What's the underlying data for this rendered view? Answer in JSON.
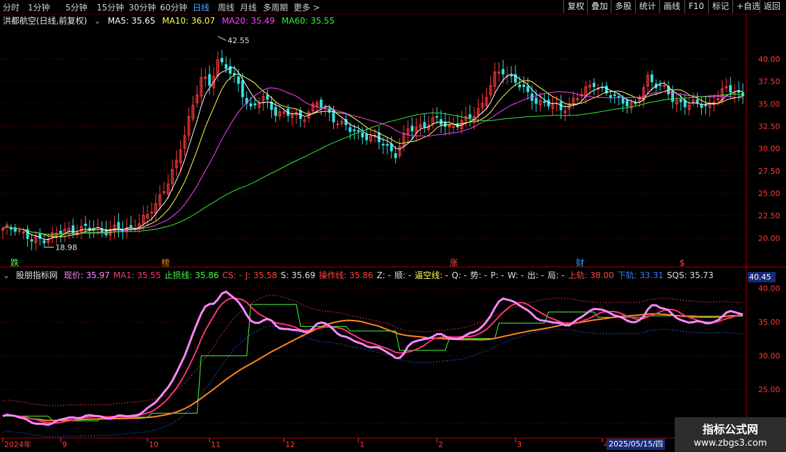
{
  "toolbar": {
    "periods": [
      "分时",
      "1分钟",
      "5分钟",
      "15分钟",
      "30分钟",
      "60分钟",
      "日线",
      "周线",
      "月线",
      "多周期",
      "更多 >"
    ],
    "active_period": "日线",
    "right_buttons": [
      "复权",
      "叠加",
      "多股",
      "统计",
      "画线",
      "F10",
      "标记",
      "+自选",
      "返回"
    ]
  },
  "main_header": {
    "stock": "洪都航空(日线,前复权)",
    "ma5": "MA5: 35.65",
    "ma10": "MA10: 36.07",
    "ma20": "MA20: 35.49",
    "ma60": "MA60: 35.55"
  },
  "colors": {
    "up": "#ff3b3b",
    "down": "#33e0e0",
    "ma5": "#ffffff",
    "ma10": "#ffff55",
    "ma20": "#ff44ff",
    "ma60": "#33ee33",
    "grid": "#5a0000",
    "axis": "#ff3b3b",
    "current": "#ff88ff",
    "ma1": "#ff3377",
    "stop": "#44ff44",
    "sqs": "#ff8822",
    "upper": "#ff4444",
    "lower": "#3366ff"
  },
  "main_axis": {
    "ticks": [
      "40.00",
      "37.50",
      "35.00",
      "32.50",
      "30.00",
      "27.50",
      "25.00",
      "22.50",
      "20.00"
    ]
  },
  "annotations": {
    "high": "42.55",
    "low": "18.98"
  },
  "events": [
    {
      "label": "跌",
      "color": "#55ff55"
    },
    {
      "label": "榜",
      "color": "#ff8800"
    },
    {
      "label": "涨",
      "color": "#ff4444"
    },
    {
      "label": "财",
      "color": "#4499ff"
    },
    {
      "label": "$",
      "color": "#ff4444"
    }
  ],
  "indicator_header": {
    "name": "股朋指标网",
    "items": [
      {
        "text": "现价: 35.97",
        "color": "#ff88ff"
      },
      {
        "text": "MA1: 35.55",
        "color": "#ff3377"
      },
      {
        "text": "止损线: 35.86",
        "color": "#44ff44"
      },
      {
        "text": "CS: -",
        "color": "#ff4444"
      },
      {
        "text": "J: 35.58",
        "color": "#ff4444"
      },
      {
        "text": "S: 35.69",
        "color": "#e0e0e0"
      },
      {
        "text": "操作线: 35.86",
        "color": "#ff4444"
      },
      {
        "text": "Z: -",
        "color": "#e0e0e0"
      },
      {
        "text": "顺: -",
        "color": "#e0e0e0"
      },
      {
        "text": "逼空线: -",
        "color": "#ffff55"
      },
      {
        "text": "Q: -",
        "color": "#e0e0e0"
      },
      {
        "text": "势: -",
        "color": "#e0e0e0"
      },
      {
        "text": "P: -",
        "color": "#e0e0e0"
      },
      {
        "text": "W: -",
        "color": "#e0e0e0"
      },
      {
        "text": "出: -",
        "color": "#e0e0e0"
      },
      {
        "text": "局: -",
        "color": "#e0e0e0"
      },
      {
        "text": "上轨: 38.00",
        "color": "#ff4444"
      },
      {
        "text": "下轨: 33.31",
        "color": "#4477ff"
      },
      {
        "text": "SQS: 35.73",
        "color": "#e0e0e0"
      }
    ]
  },
  "indicator_axis": {
    "ticks": [
      "40.00",
      "35.00",
      "30.00",
      "25.00",
      "20.00"
    ],
    "current_price": "40.45"
  },
  "time_axis": {
    "labels": [
      "2024年",
      "9",
      "10",
      "11",
      "12",
      "1",
      "2",
      "3",
      "4",
      "5"
    ],
    "cursor_date": "2025/05/15/四"
  },
  "watermark": {
    "line1": "指标公式网",
    "line2": "www.zbgs3.com"
  },
  "chart_data": [
    {
      "type": "line",
      "title": "洪都航空(日线,前复权)",
      "ylim": [
        18.0,
        43.5
      ],
      "x_sessions": 180,
      "x_months": [
        "2024-08",
        "2024-09",
        "2024-10",
        "2024-11",
        "2024-12",
        "2025-01",
        "2025-02",
        "2025-03",
        "2025-04",
        "2025-05"
      ],
      "close_keypoints": [
        [
          0,
          20.8
        ],
        [
          3,
          21.3
        ],
        [
          7,
          19.6
        ],
        [
          12,
          20.3
        ],
        [
          18,
          21.1
        ],
        [
          24,
          20.9
        ],
        [
          30,
          21.0
        ],
        [
          35,
          22.3
        ],
        [
          39,
          25.5
        ],
        [
          42,
          28.2
        ],
        [
          45,
          33.5
        ],
        [
          48,
          37.8
        ],
        [
          50,
          37.0
        ],
        [
          52,
          40.0
        ],
        [
          54,
          39.2
        ],
        [
          57,
          37.0
        ],
        [
          60,
          34.6
        ],
        [
          63,
          35.5
        ],
        [
          66,
          34.2
        ],
        [
          69,
          33.8
        ],
        [
          72,
          33.4
        ],
        [
          76,
          35.1
        ],
        [
          80,
          33.5
        ],
        [
          84,
          32.0
        ],
        [
          88,
          31.5
        ],
        [
          92,
          30.5
        ],
        [
          95,
          29.5
        ],
        [
          98,
          32.0
        ],
        [
          102,
          32.8
        ],
        [
          105,
          33.1
        ],
        [
          108,
          32.5
        ],
        [
          112,
          33.0
        ],
        [
          116,
          35.0
        ],
        [
          119,
          38.0
        ],
        [
          121,
          38.8
        ],
        [
          124,
          37.5
        ],
        [
          127,
          36.0
        ],
        [
          131,
          35.0
        ],
        [
          135,
          34.5
        ],
        [
          139,
          35.6
        ],
        [
          143,
          37.5
        ],
        [
          146,
          36.0
        ],
        [
          150,
          35.5
        ],
        [
          153,
          34.6
        ],
        [
          156,
          38.0
        ],
        [
          159,
          37.0
        ],
        [
          162,
          35.5
        ],
        [
          165,
          35.1
        ],
        [
          168,
          34.8
        ],
        [
          171,
          35.0
        ],
        [
          174,
          36.3
        ],
        [
          177,
          36.6
        ],
        [
          179,
          35.9
        ]
      ],
      "series": [
        {
          "name": "MA5",
          "last": 35.65
        },
        {
          "name": "MA10",
          "last": 36.07
        },
        {
          "name": "MA20",
          "last": 35.49
        },
        {
          "name": "MA60",
          "last": 35.55
        }
      ],
      "high": 42.55,
      "low": 18.98
    },
    {
      "type": "line",
      "title": "股朋指标网",
      "ylim": [
        18.0,
        41.0
      ],
      "series": [
        {
          "name": "现价",
          "last": 35.97
        },
        {
          "name": "MA1",
          "last": 35.55
        },
        {
          "name": "止损线",
          "last": 35.86
        },
        {
          "name": "上轨",
          "last": 38.0
        },
        {
          "name": "下轨",
          "last": 33.31
        },
        {
          "name": "SQS",
          "last": 35.73
        }
      ]
    }
  ]
}
